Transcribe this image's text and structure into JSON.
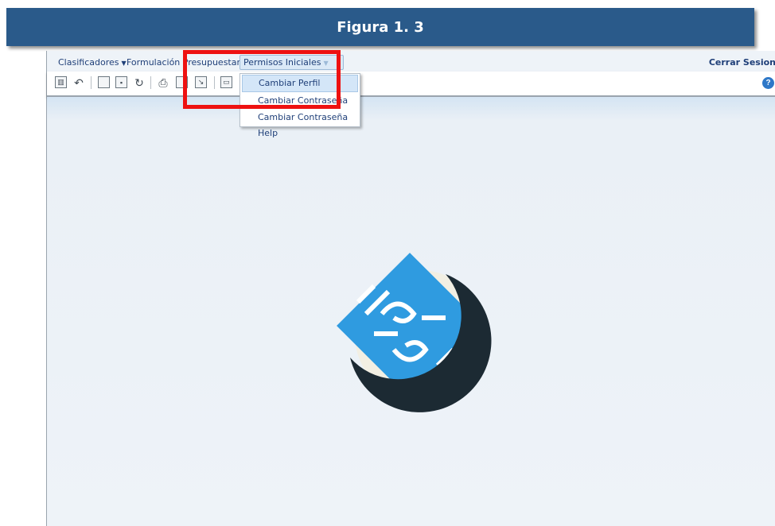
{
  "banner": {
    "title": "Figura 1. 3"
  },
  "menubar": {
    "items": [
      {
        "label": "Clasificadores",
        "caret": "▼"
      },
      {
        "label": "Formulación Presupuestaria",
        "caret": "▼"
      },
      {
        "label": "Permisos Iniciales",
        "caret": "▼"
      }
    ],
    "logout_label": "Cerrar Sesion"
  },
  "dropdown": {
    "options": [
      {
        "label": "Cambiar Perfil"
      },
      {
        "label": "Cambiar Contraseña"
      },
      {
        "label": "Cambiar Contraseña Help"
      }
    ]
  },
  "toolbar": {
    "icons": [
      "home-icon",
      "undo-icon",
      "new-document-icon",
      "save-icon",
      "refresh-icon",
      "print-icon",
      "export-icon",
      "import-icon",
      "view-icon"
    ],
    "help_glyph": "?"
  },
  "colors": {
    "banner": "#2a5a8a",
    "highlight": "#ee1111",
    "logo_light": "#2f9be0",
    "logo_dark": "#1c2a33"
  }
}
